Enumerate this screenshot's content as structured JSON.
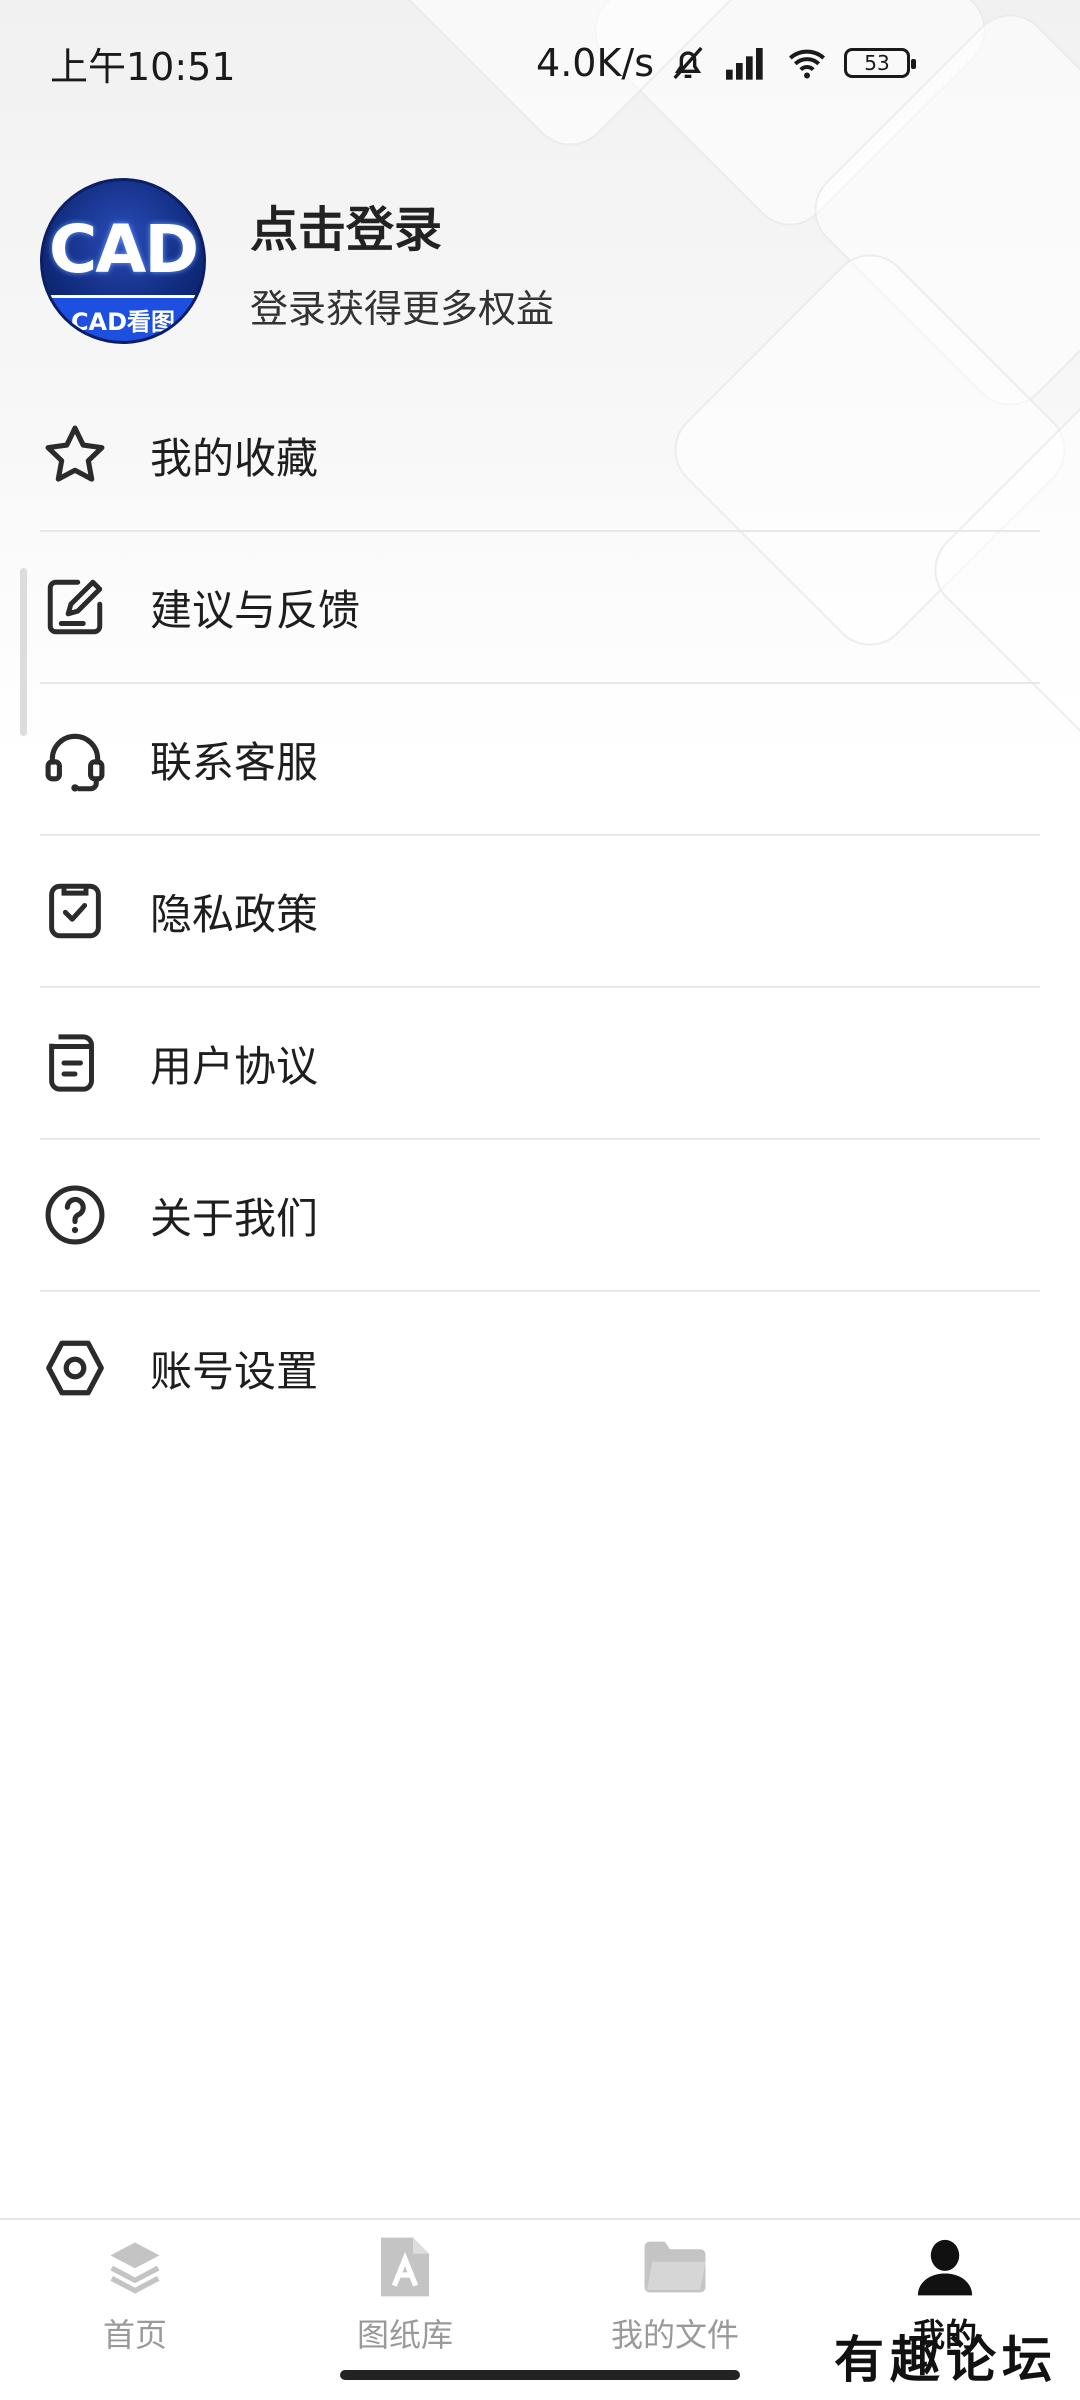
{
  "status_bar": {
    "time": "上午10:51",
    "net_speed": "4.0K/s",
    "battery": "53"
  },
  "profile": {
    "avatar_text": "CAD",
    "avatar_band_text": "CAD看图",
    "title": "点击登录",
    "subtitle": "登录获得更多权益"
  },
  "menu": {
    "items": [
      {
        "label": "我的收藏",
        "icon": "star-icon"
      },
      {
        "label": "建议与反馈",
        "icon": "edit-icon"
      },
      {
        "label": "联系客服",
        "icon": "headset-icon"
      },
      {
        "label": "隐私政策",
        "icon": "checklist-icon"
      },
      {
        "label": "用户协议",
        "icon": "document-icon"
      },
      {
        "label": "关于我们",
        "icon": "question-icon"
      },
      {
        "label": "账号设置",
        "icon": "hex-settings-icon"
      }
    ]
  },
  "bottom_nav": {
    "items": [
      {
        "label": "首页",
        "icon": "layers-icon",
        "active": false
      },
      {
        "label": "图纸库",
        "icon": "drawing-file-icon",
        "active": false
      },
      {
        "label": "我的文件",
        "icon": "folder-icon",
        "active": false
      },
      {
        "label": "我的",
        "icon": "person-icon",
        "active": true
      }
    ]
  },
  "watermark": "有趣论坛",
  "colors": {
    "icon_stroke": "#2b2b2b",
    "inactive_nav": "#c4c4c4",
    "active_nav": "#111111",
    "avatar_band": "#1d4fe0"
  }
}
